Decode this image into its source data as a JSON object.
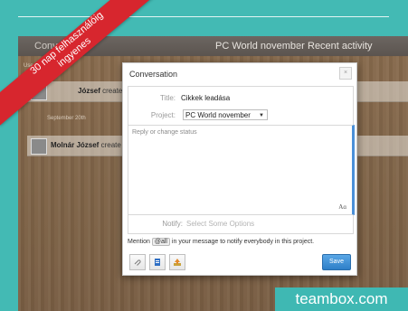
{
  "header": {
    "tab": "Convers...",
    "project": "PC World november",
    "section": "Recent activity"
  },
  "feed": {
    "meta1": "Use … Th…",
    "meta2": "September 20th",
    "rows": [
      {
        "name": "József",
        "action": "create"
      },
      {
        "name": "Molnár József",
        "action": "create"
      }
    ]
  },
  "modal": {
    "title": "Conversation",
    "close": "×",
    "title_label": "Title:",
    "title_value": "Cikkek leadása",
    "project_label": "Project:",
    "project_value": "PC World november",
    "status_placeholder": "Reply or change status",
    "text_size": "Aɑ",
    "notify_label": "Notify:",
    "notify_placeholder": "Select Some Options",
    "mention_prefix": "Mention",
    "mention_chip": "@all",
    "mention_suffix": "in your message to notify everybody in this project.",
    "save_label": "Save"
  },
  "banner": {
    "line1": "30 nap felhasználóig",
    "line2": "ingyenes"
  },
  "brand": "teambox.com",
  "colors": {
    "teal": "#43bab4",
    "banner_red": "#d7262e",
    "save_blue": "#2e7fc8"
  }
}
